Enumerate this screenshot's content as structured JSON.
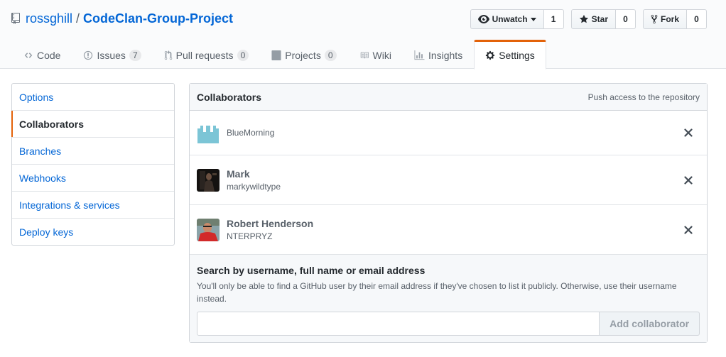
{
  "repo": {
    "owner": "rossghill",
    "separator": "/",
    "name": "CodeClan-Group-Project"
  },
  "actions": {
    "watch": {
      "label": "Unwatch",
      "count": "1"
    },
    "star": {
      "label": "Star",
      "count": "0"
    },
    "fork": {
      "label": "Fork",
      "count": "0"
    }
  },
  "tabs": [
    {
      "label": "Code",
      "icon": "code-icon"
    },
    {
      "label": "Issues",
      "badge": "7",
      "icon": "issue-icon"
    },
    {
      "label": "Pull requests",
      "badge": "0",
      "icon": "pull-request-icon"
    },
    {
      "label": "Projects",
      "badge": "0",
      "icon": "project-icon"
    },
    {
      "label": "Wiki",
      "icon": "book-icon"
    },
    {
      "label": "Insights",
      "icon": "graph-icon"
    },
    {
      "label": "Settings",
      "icon": "gear-icon",
      "selected": true
    }
  ],
  "sidebar": {
    "items": [
      {
        "label": "Options"
      },
      {
        "label": "Collaborators",
        "selected": true
      },
      {
        "label": "Branches"
      },
      {
        "label": "Webhooks"
      },
      {
        "label": "Integrations & services"
      },
      {
        "label": "Deploy keys"
      }
    ]
  },
  "collaborators": {
    "title": "Collaborators",
    "note": "Push access to the repository",
    "list": [
      {
        "name": "",
        "login": "BlueMorning"
      },
      {
        "name": "Mark",
        "login": "markywildtype"
      },
      {
        "name": "Robert Henderson",
        "login": "NTERPRYZ"
      }
    ],
    "search": {
      "title": "Search by username, full name or email address",
      "note": "You'll only be able to find a GitHub user by their email address if they've chosen to list it publicly. Otherwise, use their username instead.",
      "placeholder": "",
      "value": "",
      "button_label": "Add collaborator"
    }
  },
  "colors": {
    "link": "#0366d6",
    "accent": "#e36209",
    "text": "#24292e",
    "muted": "#586069"
  }
}
